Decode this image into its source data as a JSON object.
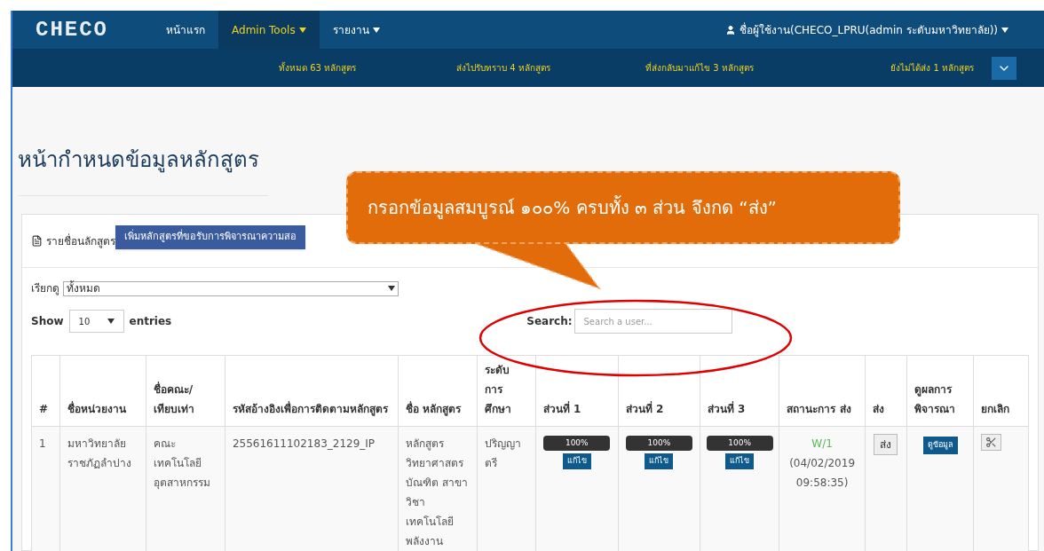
{
  "navbar": {
    "brand": "CHECO",
    "items": [
      {
        "label": "หน้าแรก",
        "selected": false,
        "dropdown": false
      },
      {
        "label": "Admin Tools",
        "selected": true,
        "dropdown": true
      },
      {
        "label": "รายงาน",
        "selected": false,
        "dropdown": true
      }
    ],
    "user": "ชื่อผู้ใช้งาน(CHECO_LPRU(admin ระดับมหาวิทยาลัย))"
  },
  "summary_bar": [
    "ทั้งหมด 63 หลักสูตร",
    "ส่งไปรับทราบ 4 หลักสูตร",
    "ที่ส่งกลับมาแก้ไข 3 หลักสูตร",
    "ยังไม่ได้ส่ง 1 หลักสูตร"
  ],
  "page_title": "หน้ากำหนดข้อมูลหลักสูตร",
  "panel": {
    "heading": "รายชื่อนลักสูตร",
    "add_button": "เพิ่มหลักสูตรที่ขอรับการพิจารณาความสอ"
  },
  "filter": {
    "label": "เรียกดู",
    "value": "ทั้งหมด"
  },
  "length": {
    "show": "Show",
    "value": "10",
    "entries": "entries"
  },
  "search": {
    "label": "Search:",
    "placeholder": "Search a user..."
  },
  "table": {
    "columns": [
      "#",
      "ชื่อหน่วยงาน",
      "ชื่อคณะ/ เทียบเท่า",
      "รหัสอ้างอิงเพื่อการติดตามหลักสูตร",
      "ชื่อ หลักสูตร",
      "ระดับ การ ศึกษา",
      "ส่วนที่ 1",
      "ส่วนที่ 2",
      "ส่วนที่ 3",
      "สถานะการ ส่ง",
      "ส่ง",
      "ดูผลการ พิจารณา",
      "ยกเลิก"
    ],
    "rows": [
      {
        "number": "1",
        "unit": "มหาวิทยาลัยราชภัฏลำปาง",
        "faculty": "คณะเทคโนโลยีอุตสาหกรรม",
        "reference": "25561611102183_2129_IP",
        "program": "หลักสูตรวิทยาศาสตรบัณฑิต สาขาวิชาเทคโนโลยีพลังงาน",
        "level": "ปริญญาตรี",
        "parts": [
          {
            "level": 1,
            "reading": "100%",
            "edit": "แก้ไข"
          },
          {
            "level": 1,
            "reading": "100%",
            "edit": "แก้ไข"
          },
          {
            "level": 1,
            "reading": "100%",
            "edit": "แก้ไข"
          }
        ],
        "status": {
          "text": "W/1",
          "color": "#5cb85c"
        },
        "status_time": "(04/02/2019 09:58:35)",
        "send": "ส่ง",
        "view": "ดูข้อมูล"
      }
    ]
  },
  "callout": "กรอกข้อมูลสมบูรณ์ ๑๐๐% ครบทั้ง ๓ ส่วน จึงกด “ส่ง”"
}
